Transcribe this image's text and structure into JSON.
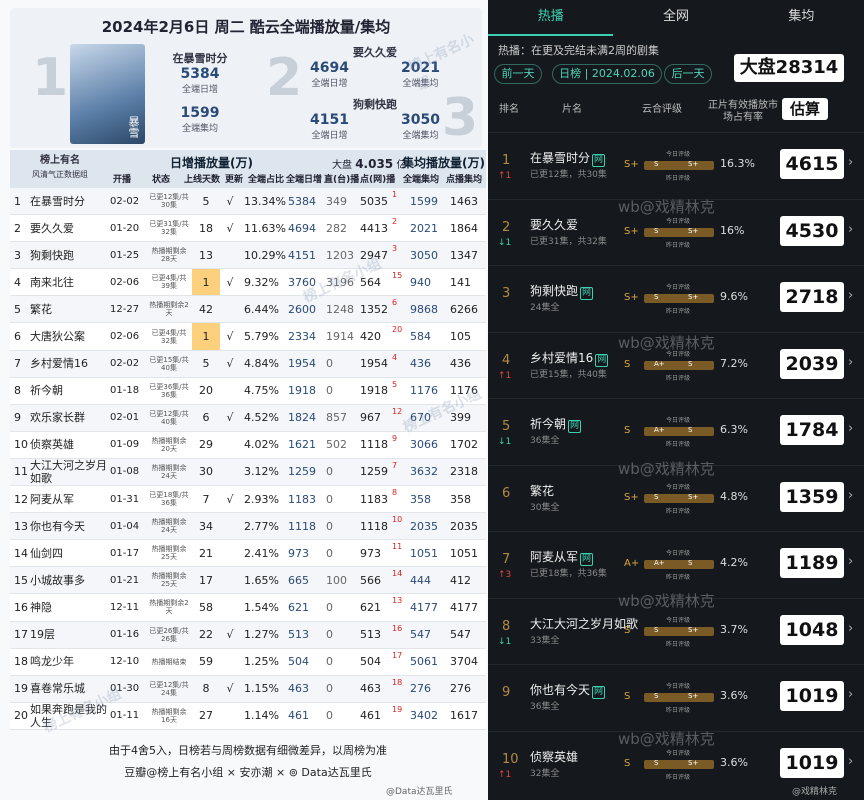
{
  "left": {
    "title": "2024年2月6日  周二  酷云全端播放量/集均",
    "top3": [
      {
        "rank": "1",
        "name": "在暴雪时分",
        "daily": "5384",
        "daily_label": "全端日增",
        "avg": "1599",
        "avg_label": "全端集均",
        "poster": "暴雪"
      },
      {
        "rank": "2",
        "name": "要久久爱",
        "daily": "4694",
        "daily_label": "全端日增",
        "avg": "2021",
        "avg_label": "全端集均"
      },
      {
        "rank": "3",
        "name": "狗剩快跑",
        "daily": "4151",
        "daily_label": "全端日增",
        "avg": "3050",
        "avg_label": "全端集均"
      }
    ],
    "logo_main": "榜上有名",
    "logo_sub": "风清气正数据组",
    "group_daily": "日增播放量(万)",
    "total_label": "大盘",
    "total_value": "4.035",
    "total_unit": "亿",
    "group_avg": "集均播放量(万)",
    "headers": [
      "开播",
      "状态",
      "上线天数",
      "更新",
      "全端占比",
      "全端日增",
      "直(台)播",
      "点(网)播",
      "全端集均",
      "点播集均"
    ],
    "rows": [
      {
        "no": "1",
        "name": "在暴雪时分",
        "start": "02-02",
        "status": "已更12集/共30集",
        "days": "5",
        "upd": "√",
        "share": "13.34%",
        "daily": "5384",
        "tv": "349",
        "net": "5035",
        "r": "1",
        "avg": "1599",
        "navg": "1463",
        "hl": false
      },
      {
        "no": "2",
        "name": "要久久爱",
        "start": "01-20",
        "status": "已更31集/共32集",
        "days": "18",
        "upd": "√",
        "share": "11.63%",
        "daily": "4694",
        "tv": "282",
        "net": "4413",
        "r": "2",
        "avg": "2021",
        "navg": "1864",
        "hl": false
      },
      {
        "no": "3",
        "name": "狗剩快跑",
        "start": "01-25",
        "status": "热播期剩余28天",
        "days": "13",
        "upd": "",
        "share": "10.29%",
        "daily": "4151",
        "tv": "1203",
        "net": "2947",
        "r": "3",
        "avg": "3050",
        "navg": "1347",
        "hl": false
      },
      {
        "no": "4",
        "name": "南来北往",
        "start": "02-06",
        "status": "已更4集/共39集",
        "days": "1",
        "upd": "√",
        "share": "9.32%",
        "daily": "3760",
        "tv": "3196",
        "net": "564",
        "r": "15",
        "avg": "940",
        "navg": "141",
        "hl": true
      },
      {
        "no": "5",
        "name": "繁花",
        "start": "12-27",
        "status": "热播期剩余2天",
        "days": "42",
        "upd": "",
        "share": "6.44%",
        "daily": "2600",
        "tv": "1248",
        "net": "1352",
        "r": "6",
        "avg": "9868",
        "navg": "6266",
        "hl": false
      },
      {
        "no": "6",
        "name": "大唐狄公案",
        "start": "02-06",
        "status": "已更4集/共32集",
        "days": "1",
        "upd": "√",
        "share": "5.79%",
        "daily": "2334",
        "tv": "1914",
        "net": "420",
        "r": "20",
        "avg": "584",
        "navg": "105",
        "hl": true
      },
      {
        "no": "7",
        "name": "乡村爱情16",
        "start": "02-02",
        "status": "已更15集/共40集",
        "days": "5",
        "upd": "√",
        "share": "4.84%",
        "daily": "1954",
        "tv": "0",
        "net": "1954",
        "r": "4",
        "avg": "436",
        "navg": "436",
        "hl": false
      },
      {
        "no": "8",
        "name": "祈今朝",
        "start": "01-18",
        "status": "已更36集/共36集",
        "days": "20",
        "upd": "",
        "share": "4.75%",
        "daily": "1918",
        "tv": "0",
        "net": "1918",
        "r": "5",
        "avg": "1176",
        "navg": "1176",
        "hl": false
      },
      {
        "no": "9",
        "name": "欢乐家长群",
        "start": "02-01",
        "status": "已更12集/共40集",
        "days": "6",
        "upd": "√",
        "share": "4.52%",
        "daily": "1824",
        "tv": "857",
        "net": "967",
        "r": "12",
        "avg": "670",
        "navg": "399",
        "hl": false
      },
      {
        "no": "10",
        "name": "侦察英雄",
        "start": "01-09",
        "status": "热播期剩余20天",
        "days": "29",
        "upd": "",
        "share": "4.02%",
        "daily": "1621",
        "tv": "502",
        "net": "1118",
        "r": "9",
        "avg": "3066",
        "navg": "1702",
        "hl": false
      },
      {
        "no": "11",
        "name": "大江大河之岁月如歌",
        "start": "01-08",
        "status": "热播期剩余24天",
        "days": "30",
        "upd": "",
        "share": "3.12%",
        "daily": "1259",
        "tv": "0",
        "net": "1259",
        "r": "7",
        "avg": "3632",
        "navg": "2318",
        "hl": false
      },
      {
        "no": "12",
        "name": "阿麦从军",
        "start": "01-31",
        "status": "已更18集/共36集",
        "days": "7",
        "upd": "√",
        "share": "2.93%",
        "daily": "1183",
        "tv": "0",
        "net": "1183",
        "r": "8",
        "avg": "358",
        "navg": "358",
        "hl": false
      },
      {
        "no": "13",
        "name": "你也有今天",
        "start": "01-04",
        "status": "热播期剩余24天",
        "days": "34",
        "upd": "",
        "share": "2.77%",
        "daily": "1118",
        "tv": "0",
        "net": "1118",
        "r": "10",
        "avg": "2035",
        "navg": "2035",
        "hl": false
      },
      {
        "no": "14",
        "name": "仙剑四",
        "start": "01-17",
        "status": "热播期剩余25天",
        "days": "21",
        "upd": "",
        "share": "2.41%",
        "daily": "973",
        "tv": "0",
        "net": "973",
        "r": "11",
        "avg": "1051",
        "navg": "1051",
        "hl": false
      },
      {
        "no": "15",
        "name": "小城故事多",
        "start": "01-21",
        "status": "热播期剩余25天",
        "days": "17",
        "upd": "",
        "share": "1.65%",
        "daily": "665",
        "tv": "100",
        "net": "566",
        "r": "14",
        "avg": "444",
        "navg": "412",
        "hl": false
      },
      {
        "no": "16",
        "name": "神隐",
        "start": "12-11",
        "status": "热播期剩余2天",
        "days": "58",
        "upd": "",
        "share": "1.54%",
        "daily": "621",
        "tv": "0",
        "net": "621",
        "r": "13",
        "avg": "4177",
        "navg": "4177",
        "hl": false
      },
      {
        "no": "17",
        "name": "19层",
        "start": "01-16",
        "status": "已更26集/共26集",
        "days": "22",
        "upd": "√",
        "share": "1.27%",
        "daily": "513",
        "tv": "0",
        "net": "513",
        "r": "16",
        "avg": "547",
        "navg": "547",
        "hl": false
      },
      {
        "no": "18",
        "name": "鸣龙少年",
        "start": "12-10",
        "status": "热播期结束",
        "days": "59",
        "upd": "",
        "share": "1.25%",
        "daily": "504",
        "tv": "0",
        "net": "504",
        "r": "17",
        "avg": "5061",
        "navg": "3704",
        "hl": false
      },
      {
        "no": "19",
        "name": "喜卷常乐城",
        "start": "01-30",
        "status": "已更12集/共24集",
        "days": "8",
        "upd": "√",
        "share": "1.15%",
        "daily": "463",
        "tv": "0",
        "net": "463",
        "r": "18",
        "avg": "276",
        "navg": "276",
        "hl": false
      },
      {
        "no": "20",
        "name": "如果奔跑是我的人生",
        "start": "01-11",
        "status": "热播期剩余16天",
        "days": "27",
        "upd": "",
        "share": "1.14%",
        "daily": "461",
        "tv": "0",
        "net": "461",
        "r": "19",
        "avg": "3402",
        "navg": "1617",
        "hl": false
      }
    ],
    "footer1": "由于4舍5入，日榜若与周榜数据有细微差异，以周榜为准",
    "footer2": "豆瓣@榜上有名小组 × 安亦潮 × ⊚ Data达瓦里氏",
    "watermark": "榜上有名小组",
    "weibo_mark": "@Data达瓦里氏"
  },
  "right": {
    "tabs": [
      "热播",
      "全网",
      "集均"
    ],
    "subtitle": "热播：在更及完结未满2周的剧集",
    "prev_label": "前一天",
    "date_label": "日榜 | 2024.02.06",
    "next_label": "后一天",
    "total": "大盘28314",
    "col_rank": "排名",
    "col_name": "片名",
    "col_rating": "云合评级",
    "col_share": "正片有效播放市场占有率",
    "col_est": "估算",
    "today_label": "今日评级",
    "yesterday_label": "昨日评级",
    "rows": [
      {
        "rank": "1",
        "chg": "↑1",
        "chg_color": "#e0483a",
        "name": "在暴雪时分",
        "tag": "网",
        "sub": "已更12集，共30集",
        "grade": "S+",
        "a": "S",
        "b": "S+",
        "share": "16.3%",
        "est": "4615"
      },
      {
        "rank": "2",
        "chg": "↓1",
        "chg_color": "#3cd0b0",
        "name": "要久久爱",
        "tag": "",
        "sub": "已更31集，共32集",
        "grade": "S+",
        "a": "S",
        "b": "S+",
        "share": "16%",
        "est": "4530"
      },
      {
        "rank": "3",
        "chg": "",
        "chg_color": "#888",
        "name": "狗剩快跑",
        "tag": "网",
        "sub": "24集全",
        "grade": "S+",
        "a": "S",
        "b": "S+",
        "share": "9.6%",
        "est": "2718"
      },
      {
        "rank": "4",
        "chg": "↑1",
        "chg_color": "#e0483a",
        "name": "乡村爱情16",
        "tag": "网",
        "sub": "已更15集，共40集",
        "grade": "S",
        "a": "A+",
        "b": "S",
        "share": "7.2%",
        "est": "2039"
      },
      {
        "rank": "5",
        "chg": "↓1",
        "chg_color": "#3cd0b0",
        "name": "祈今朝",
        "tag": "网",
        "sub": "36集全",
        "grade": "S",
        "a": "A+",
        "b": "S",
        "share": "6.3%",
        "est": "1784"
      },
      {
        "rank": "6",
        "chg": "",
        "chg_color": "#888",
        "name": "繁花",
        "tag": "",
        "sub": "30集全",
        "grade": "S+",
        "a": "S",
        "b": "S+",
        "share": "4.8%",
        "est": "1359"
      },
      {
        "rank": "7",
        "chg": "↑3",
        "chg_color": "#e0483a",
        "name": "阿麦从军",
        "tag": "网",
        "sub": "已更18集，共36集",
        "grade": "A+",
        "a": "A+",
        "b": "S",
        "share": "4.2%",
        "est": "1189"
      },
      {
        "rank": "8",
        "chg": "↓1",
        "chg_color": "#3cd0b0",
        "name": "大江大河之岁月如歌",
        "tag": "",
        "sub": "33集全",
        "grade": "S",
        "a": "S",
        "b": "S+",
        "share": "3.7%",
        "est": "1048"
      },
      {
        "rank": "9",
        "chg": "",
        "chg_color": "#888",
        "name": "你也有今天",
        "tag": "网",
        "sub": "36集全",
        "grade": "S",
        "a": "S",
        "b": "S+",
        "share": "3.6%",
        "est": "1019"
      },
      {
        "rank": "10",
        "chg": "↑1",
        "chg_color": "#e0483a",
        "name": "侦察英雄",
        "tag": "",
        "sub": "32集全",
        "grade": "S",
        "a": "S",
        "b": "S+",
        "share": "3.6%",
        "est": "1019"
      }
    ],
    "watermark": "wb@戏精林克",
    "weibo_mark": "@戏精林克"
  }
}
